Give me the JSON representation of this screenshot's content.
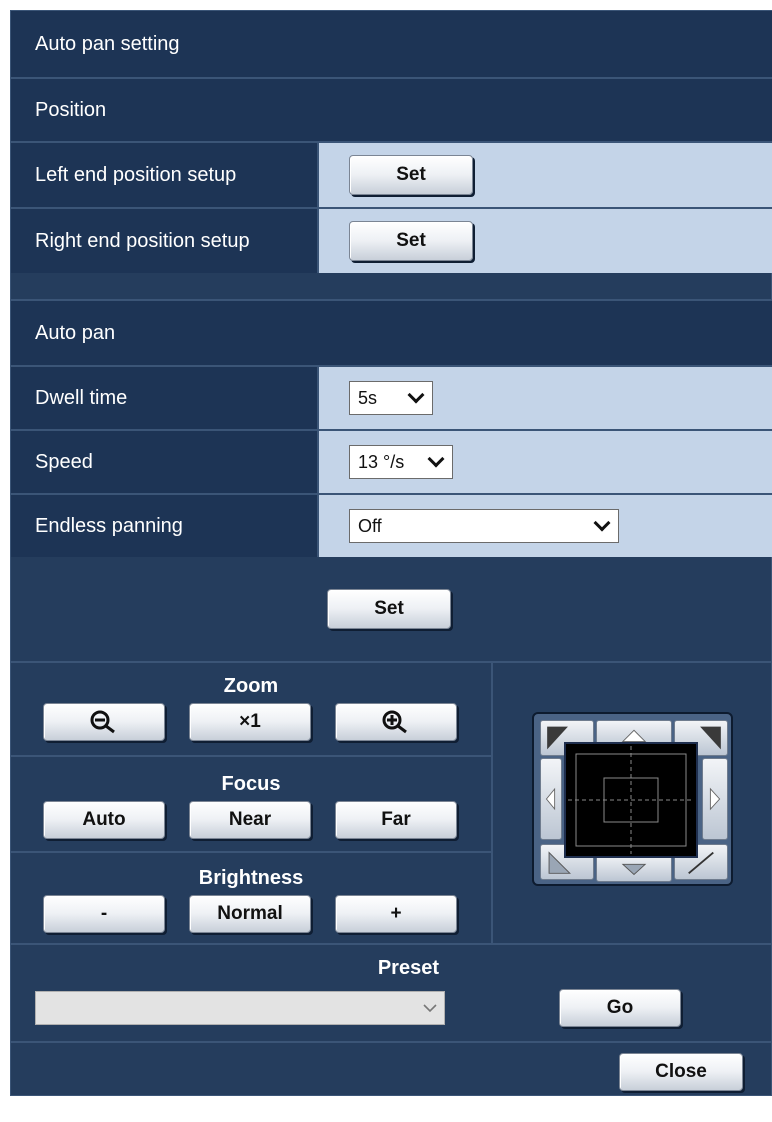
{
  "title": "Auto pan setting",
  "position": {
    "header": "Position",
    "left_end": {
      "label": "Left end position setup",
      "button": "Set"
    },
    "right_end": {
      "label": "Right end position setup",
      "button": "Set"
    }
  },
  "auto_pan": {
    "header": "Auto pan",
    "dwell_time": {
      "label": "Dwell time",
      "value": "5s"
    },
    "speed": {
      "label": "Speed",
      "value": "13 °/s"
    },
    "endless_panning": {
      "label": "Endless panning",
      "value": "Off"
    },
    "set_button": "Set"
  },
  "controls": {
    "zoom": {
      "label": "Zoom",
      "reset": "×1"
    },
    "focus": {
      "label": "Focus",
      "auto": "Auto",
      "near": "Near",
      "far": "Far"
    },
    "brightness": {
      "label": "Brightness",
      "minus": "-",
      "normal": "Normal",
      "plus": "+"
    }
  },
  "preset": {
    "label": "Preset",
    "value": "",
    "go_button": "Go"
  },
  "close_button": "Close",
  "colors": {
    "header_bg": "#1d3455",
    "panel_bg": "#253d5d",
    "value_bg": "#c4d4e8",
    "divider": "#3b5577"
  },
  "icons": [
    "zoom-out-icon",
    "zoom-in-icon",
    "pan-up-icon",
    "pan-down-icon",
    "pan-left-icon",
    "pan-right-icon",
    "pan-up-left-icon",
    "pan-up-right-icon",
    "pan-down-left-icon",
    "pan-down-right-icon",
    "chevron-down-icon"
  ]
}
